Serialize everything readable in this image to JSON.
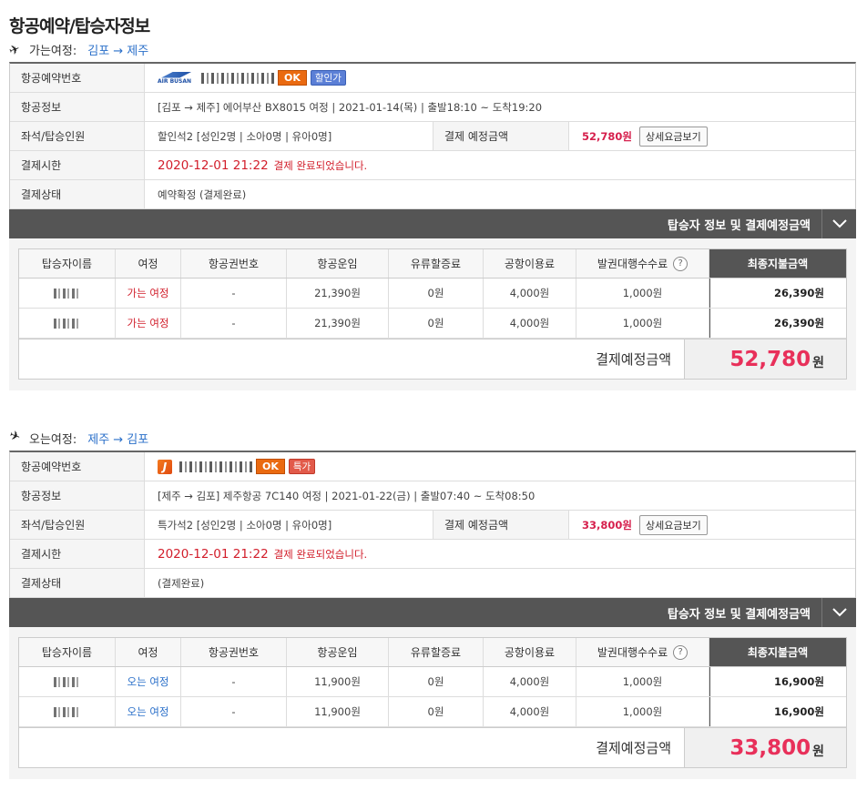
{
  "page_title": "항공예약/탑승자정보",
  "legs": [
    {
      "direction_label": "가는여정:",
      "route": "김포 → 제주",
      "rows": {
        "booking_no_label": "항공예약번호",
        "airline_logo": "AIR BUSAN",
        "ok_badge": "OK",
        "fare_badge": "할인가",
        "flight_info_label": "항공정보",
        "flight_info": "[김포 → 제주] 에어부산 BX8015 여정 | 2021-01-14(목) | 출발18:10 ~ 도착19:20",
        "seat_label": "좌석/탑승인원",
        "seat_info": "할인석2 [성인2명 | 소아0명 | 유아0명]",
        "expected_label": "결제 예정금액",
        "expected_amount": "52,780원",
        "detail_button": "상세요금보기",
        "deadline_label": "결제시한",
        "deadline": "2020-12-01 21:22",
        "deadline_msg": "결제 완료되었습니다.",
        "status_label": "결제상태",
        "status": "예약확정 (결제완료)"
      },
      "bar_label": "탑승자 정보 및 결제예정금액",
      "pax_headers": [
        "탑승자이름",
        "여정",
        "항공권번호",
        "항공운임",
        "유류할증료",
        "공항이용료",
        "발권대행수수료",
        "최종지불금액"
      ],
      "pax_rows": [
        {
          "trip": "가는 여정",
          "ticket": "-",
          "fare": "21,390원",
          "fuel": "0원",
          "airport": "4,000원",
          "fee": "1,000원",
          "total": "26,390원"
        },
        {
          "trip": "가는 여정",
          "ticket": "-",
          "fare": "21,390원",
          "fuel": "0원",
          "airport": "4,000원",
          "fee": "1,000원",
          "total": "26,390원"
        }
      ],
      "total_label": "결제예정금액",
      "total_amount": "52,780",
      "total_unit": "원"
    },
    {
      "direction_label": "오는여정:",
      "route": "제주 → 김포",
      "rows": {
        "booking_no_label": "항공예약번호",
        "airline_logo": "J",
        "ok_badge": "OK",
        "fare_badge": "특가",
        "flight_info_label": "항공정보",
        "flight_info": "[제주 → 김포] 제주항공 7C140 여정 | 2021-01-22(금) | 출발07:40 ~ 도착08:50",
        "seat_label": "좌석/탑승인원",
        "seat_info": "특가석2 [성인2명 | 소아0명 | 유아0명]",
        "expected_label": "결제 예정금액",
        "expected_amount": "33,800원",
        "detail_button": "상세요금보기",
        "deadline_label": "결제시한",
        "deadline": "2020-12-01 21:22",
        "deadline_msg": "결제 완료되었습니다.",
        "status_label": "결제상태",
        "status": "(결제완료)"
      },
      "bar_label": "탑승자 정보 및 결제예정금액",
      "pax_headers": [
        "탑승자이름",
        "여정",
        "항공권번호",
        "항공운임",
        "유류할증료",
        "공항이용료",
        "발권대행수수료",
        "최종지불금액"
      ],
      "pax_rows": [
        {
          "trip": "오는 여정",
          "ticket": "-",
          "fare": "11,900원",
          "fuel": "0원",
          "airport": "4,000원",
          "fee": "1,000원",
          "total": "16,900원"
        },
        {
          "trip": "오는 여정",
          "ticket": "-",
          "fare": "11,900원",
          "fuel": "0원",
          "airport": "4,000원",
          "fee": "1,000원",
          "total": "16,900원"
        }
      ],
      "total_label": "결제예정금액",
      "total_amount": "33,800",
      "total_unit": "원"
    }
  ],
  "icons": {
    "departure": "airplane-takeoff-icon",
    "arrival": "airplane-landing-icon",
    "toggle": "chevron-down-icon",
    "help": "question-icon"
  }
}
